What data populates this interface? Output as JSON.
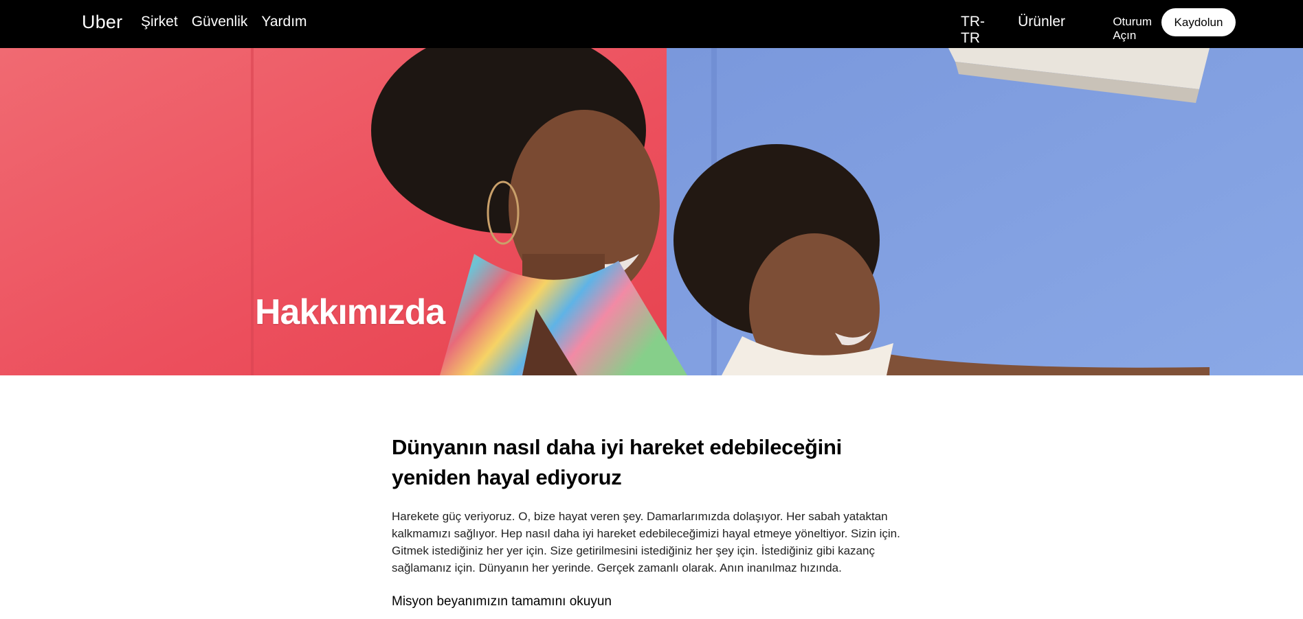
{
  "nav": {
    "logo": "Uber",
    "left_links": [
      "Şirket",
      "Güvenlik",
      "Yardım"
    ],
    "locale": "TR-TR",
    "products": "Ürünler",
    "signin": "Oturum Açın",
    "signup": "Kaydolun"
  },
  "hero": {
    "title": "Hakkımızda",
    "image": "woman-and-child-photo",
    "colors": {
      "left_wall": "#ee5360",
      "right_wall": "#7f9fe0"
    }
  },
  "content": {
    "headline": "Dünyanın nasıl daha iyi hareket edebileceğini yeniden hayal ediyoruz",
    "body": "Harekete güç veriyoruz. O, bize hayat veren şey. Damarlarımızda dolaşıyor. Her sabah yataktan kalkmamızı sağlıyor. Hep nasıl daha iyi hareket edebileceğimizi hayal etmeye yöneltiyor. Sizin için. Gitmek istediğiniz her yer için. Size getirilmesini istediğiniz her şey için. İstediğiniz gibi kazanç sağlamanız için. Dünyanın her yerinde. Gerçek zamanlı olarak. Anın inanılmaz hızında.",
    "mission_link": "Misyon beyanımızın tamamını okuyun"
  }
}
